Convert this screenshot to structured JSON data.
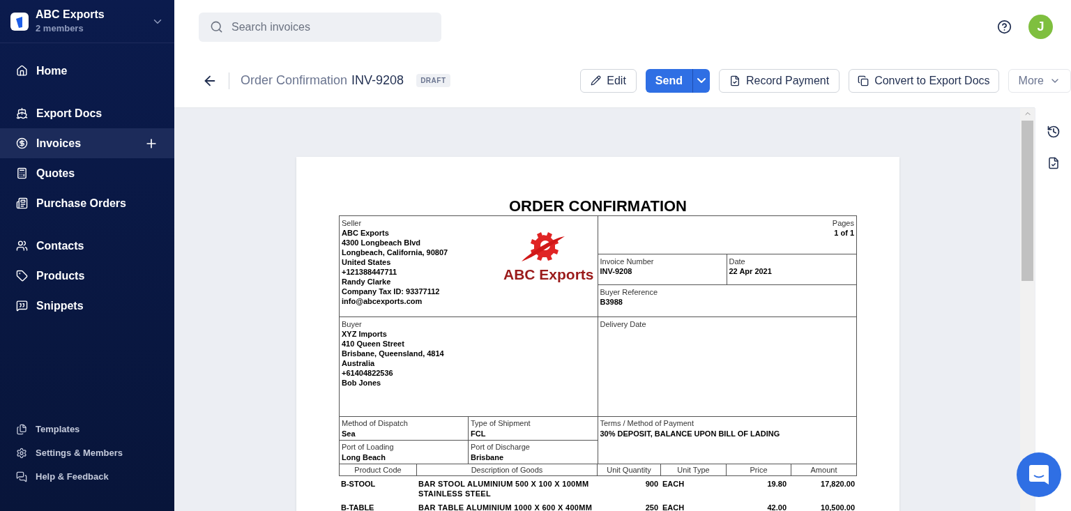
{
  "workspace": {
    "name": "ABC Exports",
    "members": "2 members"
  },
  "nav_sections": [
    {
      "items": [
        {
          "label": "Home",
          "selected": false,
          "has_add": false
        }
      ]
    },
    {
      "items": [
        {
          "label": "Export Docs",
          "selected": false,
          "has_add": false
        },
        {
          "label": "Invoices",
          "selected": true,
          "has_add": true
        },
        {
          "label": "Quotes",
          "selected": false,
          "has_add": false
        },
        {
          "label": "Purchase Orders",
          "selected": false,
          "has_add": false
        }
      ]
    },
    {
      "items": [
        {
          "label": "Contacts",
          "selected": false,
          "has_add": false
        },
        {
          "label": "Products",
          "selected": false,
          "has_add": false
        },
        {
          "label": "Snippets",
          "selected": false,
          "has_add": false
        }
      ]
    }
  ],
  "footer_links": [
    "Templates",
    "Settings & Members",
    "Help & Feedback"
  ],
  "search": {
    "placeholder": "Search invoices"
  },
  "user": {
    "initial": "J"
  },
  "doc_header": {
    "type": "Order Confirmation",
    "number": "INV-9208",
    "status": "DRAFT"
  },
  "actions": {
    "edit": "Edit",
    "send": "Send",
    "record": "Record Payment",
    "convert": "Convert to Export Docs",
    "more": "More"
  },
  "document": {
    "title": "ORDER CONFIRMATION",
    "seller": {
      "label": "Seller",
      "lines": [
        "ABC Exports",
        "4300 Longbeach Blvd",
        "Longbeach, California, 90807",
        "United States",
        "+121388447711",
        "Randy Clarke",
        "Company Tax ID: 93377112",
        "info@abcexports.com"
      ]
    },
    "logo_text": "ABC Exports",
    "pages": {
      "label": "Pages",
      "value": "1 of 1"
    },
    "invoice_number": {
      "label": "Invoice Number",
      "value": "INV-9208"
    },
    "date": {
      "label": "Date",
      "value": "22 Apr 2021"
    },
    "buyer_reference": {
      "label": "Buyer Reference",
      "value": "B3988"
    },
    "buyer": {
      "label": "Buyer",
      "lines": [
        "XYZ Imports",
        "410 Queen Street",
        "Brisbane, Queensland, 4814",
        "Australia",
        "+61404822536",
        "Bob Jones"
      ]
    },
    "delivery_date": {
      "label": "Delivery Date"
    },
    "dispatch": {
      "label": "Method of Dispatch",
      "value": "Sea"
    },
    "shipment": {
      "label": "Type of Shipment",
      "value": "FCL"
    },
    "loading": {
      "label": "Port of Loading",
      "value": "Long Beach"
    },
    "discharge": {
      "label": "Port of Discharge",
      "value": "Brisbane"
    },
    "terms": {
      "label": "Terms / Method of Payment",
      "value": "30% DEPOSIT, BALANCE UPON BILL OF LADING"
    },
    "columns": [
      "Product Code",
      "Description of Goods",
      "Unit Quantity",
      "Unit Type",
      "Price",
      "Amount"
    ],
    "rows": [
      {
        "code": "B-STOOL",
        "description": "BAR STOOL ALUMINIUM 500 X 100 X 100MM STAINLESS STEEL",
        "quantity": "900",
        "unit": "EACH",
        "price": "19.80",
        "amount": "17,820.00"
      },
      {
        "code": "B-TABLE",
        "description": "BAR TABLE ALUMINIUM 1000 X 600 X 400MM",
        "quantity": "250",
        "unit": "EACH",
        "price": "42.00",
        "amount": "10,500.00"
      }
    ]
  }
}
